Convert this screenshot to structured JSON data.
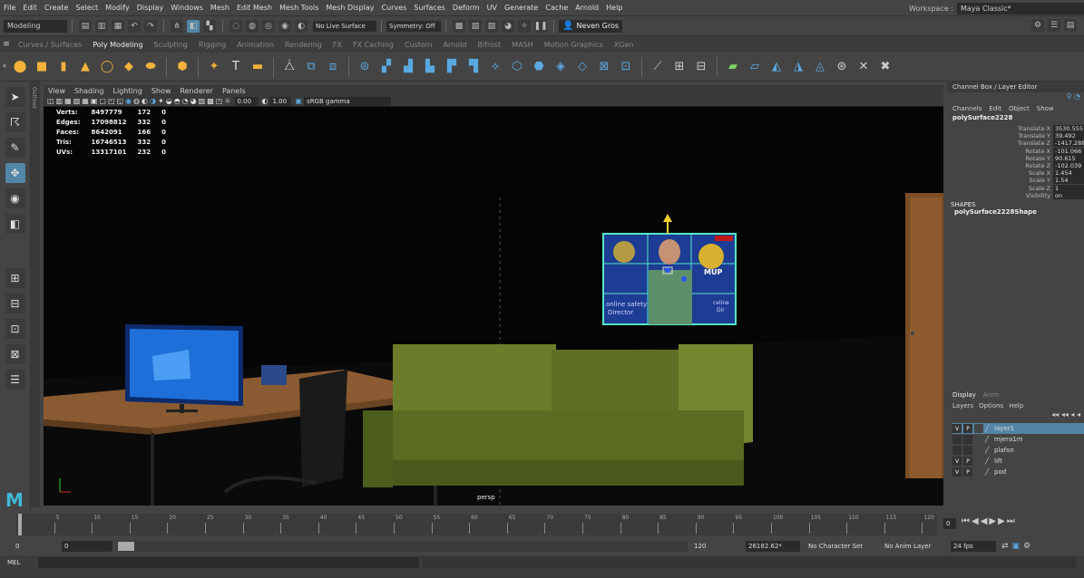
{
  "menubar": {
    "items": [
      "File",
      "Edit",
      "Create",
      "Select",
      "Modify",
      "Display",
      "Windows",
      "Mesh",
      "Edit Mesh",
      "Mesh Tools",
      "Mesh Display",
      "Curves",
      "Surfaces",
      "Deform",
      "UV",
      "Generate",
      "Cache",
      "Arnold",
      "Help"
    ],
    "workspace_label": "Workspace :",
    "workspace_value": "Maya Classic*"
  },
  "statusline": {
    "mode": "Modeling",
    "live_surface": "No Live Surface",
    "symmetry": "Symmetry: Off",
    "user": "Neven Gros"
  },
  "shelf": {
    "tabs": [
      "Curves / Surfaces",
      "Poly Modeling",
      "Sculpting",
      "Rigging",
      "Animation",
      "Rendering",
      "FX",
      "FX Caching",
      "Custom",
      "Arnold",
      "Bifrost",
      "MASH",
      "Motion Graphics",
      "XGen"
    ],
    "active_tab": "Poly Modeling"
  },
  "panel": {
    "menu": [
      "View",
      "Shading",
      "Lighting",
      "Show",
      "Renderer",
      "Panels"
    ],
    "exposure": "0.00",
    "gamma": "1.00",
    "colorspace": "sRGB gamma",
    "camera": "persp",
    "outliner_label": "Outliner"
  },
  "hud": {
    "rows": [
      {
        "label": "Verts:",
        "total": "8497779",
        "sel": "172",
        "comp": "0"
      },
      {
        "label": "Edges:",
        "total": "17098812",
        "sel": "332",
        "comp": "0"
      },
      {
        "label": "Faces:",
        "total": "8642091",
        "sel": "166",
        "comp": "0"
      },
      {
        "label": "Tris:",
        "total": "16746513",
        "sel": "332",
        "comp": "0"
      },
      {
        "label": "UVs:",
        "total": "13317101",
        "sel": "232",
        "comp": "0"
      }
    ]
  },
  "scene": {
    "poster_text_1": "online safety",
    "poster_text_2": "Director",
    "poster_badge": "MUP",
    "poster_text_3": "celine",
    "poster_text_4": "Dir"
  },
  "channelbox": {
    "title": "Channel Box / Layer Editor",
    "menu": [
      "Channels",
      "Edit",
      "Object",
      "Show"
    ],
    "object": "polySurface2228",
    "attributes": [
      {
        "name": "Translate X",
        "value": "3530.555"
      },
      {
        "name": "Translate Y",
        "value": "39.492"
      },
      {
        "name": "Translate Z",
        "value": "-1417.288"
      },
      {
        "name": "Rotate X",
        "value": "-101.066"
      },
      {
        "name": "Rotate Y",
        "value": "90.615"
      },
      {
        "name": "Rotate Z",
        "value": "-102.039"
      },
      {
        "name": "Scale X",
        "value": "1.454"
      },
      {
        "name": "Scale Y",
        "value": "1.54"
      },
      {
        "name": "Scale Z",
        "value": "1"
      },
      {
        "name": "Visibility",
        "value": "on"
      }
    ],
    "shapes_label": "SHAPES",
    "shape": "polySurface2228Shape"
  },
  "layers": {
    "tabs": [
      "Display",
      "Anim"
    ],
    "menu": [
      "Layers",
      "Options",
      "Help"
    ],
    "items": [
      {
        "v": "V",
        "p": "P",
        "name": "layer1"
      },
      {
        "v": "",
        "p": "",
        "name": "mjera1m"
      },
      {
        "v": "",
        "p": "",
        "name": "plafon"
      },
      {
        "v": "V",
        "p": "P",
        "name": "lift"
      },
      {
        "v": "V",
        "p": "P",
        "name": "pod"
      }
    ]
  },
  "timeline": {
    "ticks": [
      "5",
      "10",
      "15",
      "20",
      "25",
      "30",
      "35",
      "40",
      "45",
      "50",
      "55",
      "60",
      "65",
      "70",
      "75",
      "80",
      "85",
      "90",
      "95",
      "100",
      "105",
      "110",
      "115",
      "120"
    ],
    "current": "1",
    "current_frame_field": "0"
  },
  "range": {
    "start": "0",
    "anim_start": "0",
    "end": "120",
    "anim_end": "26182.62*",
    "character_set": "No Character Set",
    "anim_layer": "No Anim Layer",
    "fps": "24 fps"
  },
  "cmdline": {
    "label": "MEL"
  }
}
